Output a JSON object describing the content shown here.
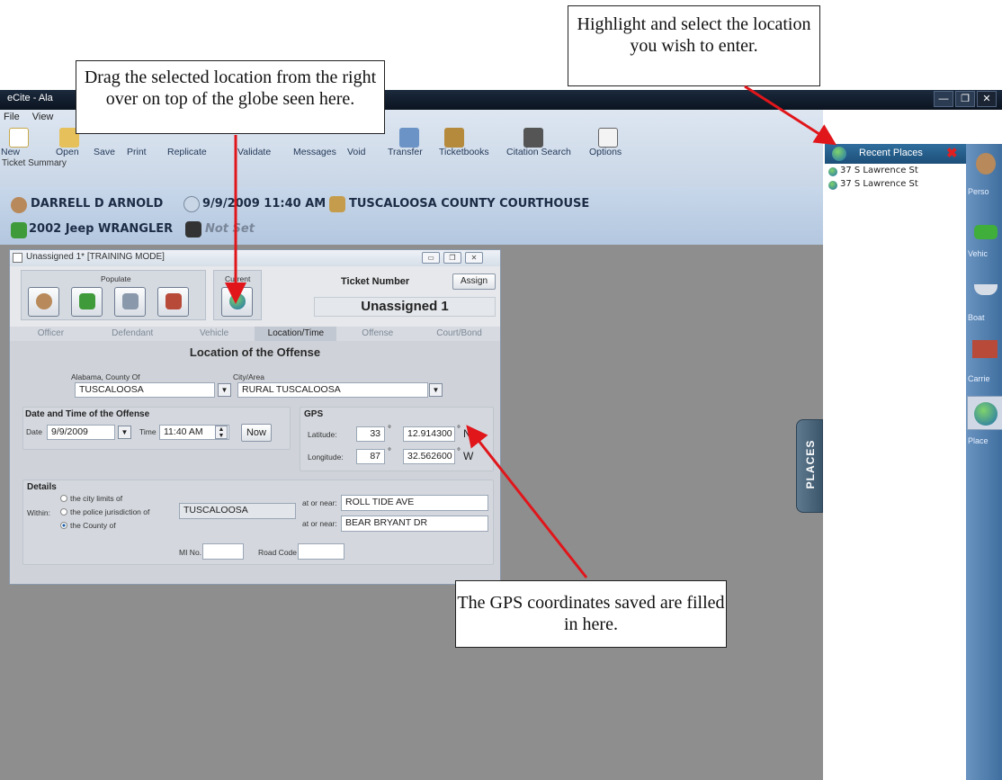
{
  "window": {
    "title": "eCite - Ala"
  },
  "menu": [
    "File",
    "View"
  ],
  "toolbar": {
    "buttons": [
      "New",
      "Open",
      "Save",
      "Print",
      "Replicate",
      "Validate",
      "Messages",
      "Void",
      "Transfer",
      "Ticketbooks",
      "Citation Search",
      "Options"
    ],
    "section_label": "Ticket Summary"
  },
  "summary": {
    "officer": "DARRELL D ARNOLD",
    "datetime": "9/9/2009 11:40 AM",
    "location": "TUSCALOOSA COUNTY COURTHOUSE",
    "vehicle": "2002 Jeep WRANGLER",
    "not_set": "Not Set"
  },
  "dialog": {
    "title": "Unassigned 1* [TRAINING MODE]",
    "populate_label": "Populate",
    "current_label": "Current",
    "ticket_number_label": "Ticket Number",
    "assign_button": "Assign",
    "ticket_number": "Unassigned 1",
    "tabs": [
      "Officer",
      "Defendant",
      "Vehicle",
      "Location/Time",
      "Offense",
      "Court/Bond"
    ],
    "active_tab": "Location/Time",
    "section_title": "Location of the Offense",
    "county_label": "Alabama, County Of",
    "county_value": "TUSCALOOSA",
    "city_label": "City/Area",
    "city_value": "RURAL TUSCALOOSA",
    "datetime_group": "Date and Time of the Offense",
    "date_label": "Date",
    "date_value": "9/9/2009",
    "time_label": "Time",
    "time_value": "11:40 AM",
    "now_button": "Now",
    "gps_group": "GPS",
    "latitude_label": "Latitude:",
    "lat_deg": "33",
    "lat_min": "12.914300",
    "lat_dir": "N",
    "longitude_label": "Longitude:",
    "lon_deg": "87",
    "lon_min": "32.562600",
    "lon_dir": "W",
    "degree_symbol": "°",
    "details_group": "Details",
    "within_label": "Within:",
    "radio_city": "the city limits of",
    "radio_police": "the police jurisdiction of",
    "radio_county": "the County of",
    "within_value": "TUSCALOOSA",
    "at_or_near_label": "at or near:",
    "at_or_near_1": "ROLL TIDE AVE",
    "at_or_near_2": "BEAR BRYANT DR",
    "mi_label": "MI No.",
    "road_code_label": "Road Code"
  },
  "places_tab": "PLACES",
  "recent_places": {
    "title": "Recent Places",
    "items": [
      "37 S Lawrence St",
      "37 S Lawrence St"
    ]
  },
  "right_bar": [
    "Perso",
    "Vehic",
    "Boat",
    "Carrie",
    "Place"
  ],
  "callouts": {
    "drag": "Drag the selected location from the right over on top of the globe seen here.",
    "highlight": "Highlight and select the location you wish to enter.",
    "gps": "The GPS coordinates saved are filled in here."
  },
  "colors": {
    "arrow": "#e0161b",
    "accent": "#1d4f78"
  }
}
